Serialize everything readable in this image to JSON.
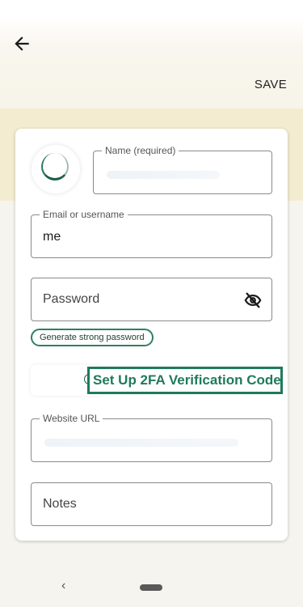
{
  "toolbar": {
    "back_icon": "arrow-left-icon",
    "save_label": "SAVE"
  },
  "form": {
    "avatar_icon": "avatar-placeholder-icon",
    "name": {
      "label": "Name (required)",
      "value": ""
    },
    "email": {
      "label": "Email or username",
      "value": "me"
    },
    "password": {
      "placeholder": "Password",
      "visibility_icon": "eye-off-icon"
    },
    "generate_label": "Generate strong password",
    "twofa": {
      "icon": "add-circle-icon",
      "label": "Set Up 2FA Verification Code"
    },
    "website": {
      "label": "Website URL",
      "value": ""
    },
    "notes": {
      "placeholder": "Notes"
    }
  },
  "navbar": {
    "back_glyph": "‹",
    "home_icon": "home-pill-icon"
  },
  "colors": {
    "accent": "#1f7a5c",
    "header_band": "#f4ecd0",
    "background": "#f6f4ef"
  }
}
